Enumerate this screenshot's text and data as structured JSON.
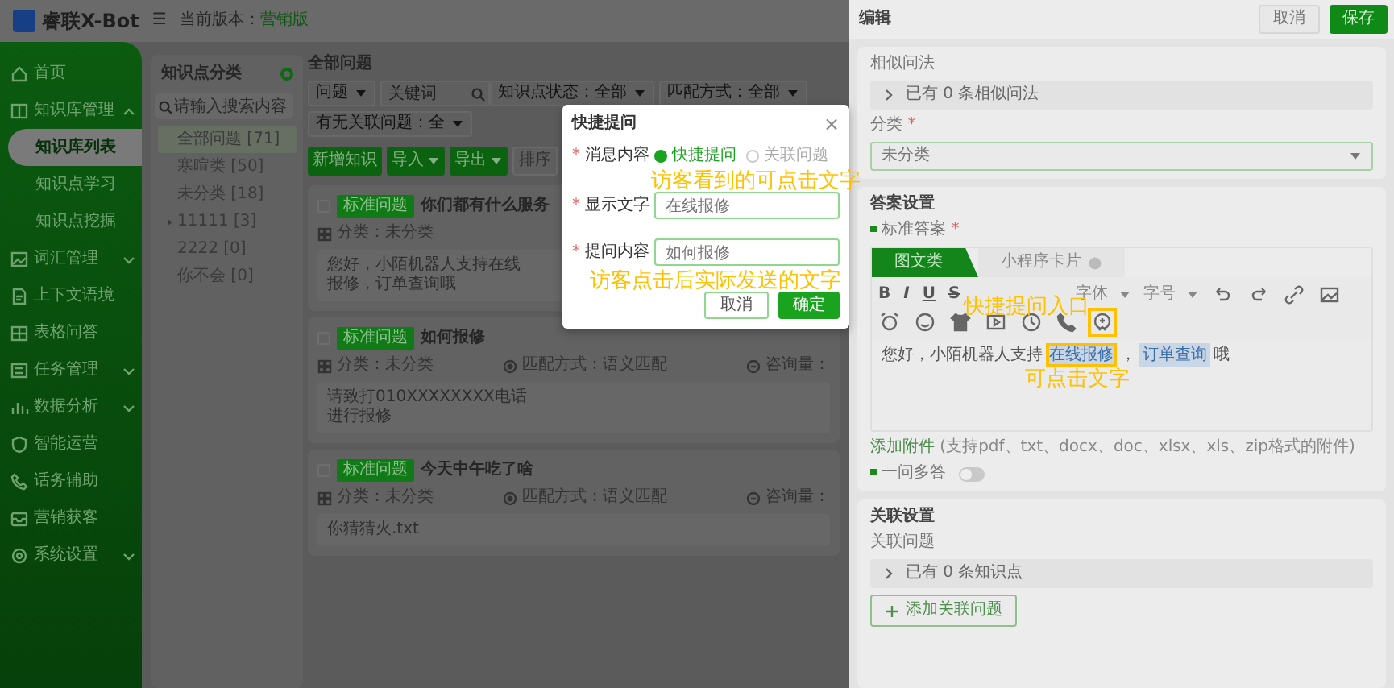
{
  "header": {
    "logo": "睿联X-Bot",
    "menu_glyph": "☰",
    "version_label": "当前版本：",
    "version": "营销版"
  },
  "sidebar": {
    "items": [
      {
        "label": "首页",
        "kind": "link",
        "selected": false
      },
      {
        "label": "知识库管理",
        "kind": "group",
        "expanded": true,
        "children": [
          {
            "label": "知识库列表",
            "selected": true
          },
          {
            "label": "知识点学习",
            "selected": false
          },
          {
            "label": "知识点挖掘",
            "selected": false
          }
        ]
      },
      {
        "label": "词汇管理",
        "kind": "group",
        "expanded": false
      },
      {
        "label": "上下文语境",
        "kind": "link",
        "selected": false
      },
      {
        "label": "表格问答",
        "kind": "link",
        "selected": false
      },
      {
        "label": "任务管理",
        "kind": "group",
        "expanded": false
      },
      {
        "label": "数据分析",
        "kind": "group",
        "expanded": false
      },
      {
        "label": "智能运营",
        "kind": "link",
        "selected": false
      },
      {
        "label": "话务辅助",
        "kind": "link",
        "selected": false
      },
      {
        "label": "营销获客",
        "kind": "link",
        "selected": false
      },
      {
        "label": "系统设置",
        "kind": "group",
        "expanded": false
      }
    ]
  },
  "categories": {
    "title": "知识点分类",
    "search": {
      "placeholder": "请输入搜索内容"
    },
    "items": [
      {
        "label": "全部问题 [71]",
        "selected": true
      },
      {
        "label": "寒暄类 [50]",
        "selected": false
      },
      {
        "label": "未分类 [18]",
        "selected": false
      },
      {
        "label": "11111 [3]",
        "selected": false,
        "expanded": false
      },
      {
        "label": "2222 [0]",
        "selected": false
      },
      {
        "label": "你不会 [0]",
        "selected": false
      }
    ]
  },
  "main": {
    "title": "全部问题",
    "filters": [
      {
        "kind": "select",
        "value": "问题"
      },
      {
        "kind": "search",
        "placeholder": "关键词"
      },
      {
        "kind": "select",
        "value": "知识点状态：全部"
      },
      {
        "kind": "select",
        "value": "匹配方式：全部"
      },
      {
        "kind": "select",
        "value": "有无关联问题：全"
      }
    ],
    "buttons": [
      {
        "label": "新增知识",
        "kind": "primary",
        "dropdown": false
      },
      {
        "label": "导入",
        "kind": "primary",
        "dropdown": true
      },
      {
        "label": "导出",
        "kind": "primary",
        "dropdown": true
      },
      {
        "label": "排序",
        "kind": "secondary",
        "dropdown": false
      }
    ],
    "items": [
      {
        "checked": false,
        "tag": "标准问题",
        "title": "你们都有什么服务",
        "category": "分类：未分类",
        "answer": "您好，小陌机器人支持在线报修，订单查询哦"
      },
      {
        "checked": false,
        "tag": "标准问题",
        "title": "如何报修",
        "category": "分类：未分类",
        "match": "匹配方式：语义匹配",
        "consult": "咨询量：",
        "answer": "请致打010XXXXXXXX电话进行报修"
      },
      {
        "checked": false,
        "tag": "标准问题",
        "title": "今天中午吃了啥",
        "category": "分类：未分类",
        "match": "匹配方式：语义匹配",
        "consult": "咨询量：",
        "answer": "你猜猜火.txt"
      }
    ]
  },
  "drawer": {
    "title": "编辑",
    "buttons": [
      {
        "label": "取消",
        "kind": "secondary"
      },
      {
        "label": "保存",
        "kind": "primary"
      }
    ],
    "similar": {
      "label": "相似问法",
      "summary": "已有 0 条相似问法",
      "expanded": false
    },
    "category": {
      "label": "分类",
      "required_mark": "*",
      "value": "未分类"
    },
    "answer": {
      "title": "答案设置",
      "label": "标准答案",
      "required_mark": "*",
      "tabs": [
        {
          "label": "图文类",
          "selected": true
        },
        {
          "label": "小程序卡片",
          "selected": false
        }
      ],
      "toolbar": {
        "format_buttons": [
          "B",
          "I",
          "U",
          "S"
        ],
        "font_select": "字体",
        "size_select": "字号",
        "quick_ask_highlighted": true
      },
      "content": [
        {
          "kind": "text",
          "text": "您好，小陌机器人支持"
        },
        {
          "kind": "link",
          "text": "在线报修",
          "highlighted": true
        },
        {
          "kind": "text",
          "text": "，"
        },
        {
          "kind": "link",
          "text": "订单查询",
          "highlighted": false
        },
        {
          "kind": "text",
          "text": "哦"
        }
      ],
      "attachment": {
        "link": "添加附件",
        "note": "(支持pdf、txt、docx、doc、xlsx、xls、zip格式的附件)"
      },
      "multi_answer": {
        "label": "一问多答",
        "on": false
      }
    },
    "relations": {
      "title": "关联设置",
      "label": "关联问题",
      "summary": "已有 0 条知识点",
      "expanded": false,
      "add_button": "添加关联问题"
    }
  },
  "modal": {
    "title": "快捷提问",
    "close": "×",
    "fields": [
      {
        "kind": "radio",
        "label": "消息内容",
        "required_mark": "*",
        "options": [
          {
            "label": "快捷提问",
            "selected": true
          },
          {
            "label": "关联问题",
            "selected": false
          }
        ]
      },
      {
        "kind": "input",
        "label": "显示文字",
        "required_mark": "*",
        "value": "在线报修"
      },
      {
        "kind": "input",
        "label": "提问内容",
        "required_mark": "*",
        "value": "如何报修"
      }
    ],
    "buttons": [
      {
        "label": "取消",
        "kind": "secondary"
      },
      {
        "label": "确定",
        "kind": "primary"
      }
    ]
  },
  "annotations": [
    {
      "text": "访客看到的可点击文字"
    },
    {
      "text": "访客点击后实际发送的文字"
    },
    {
      "text": "快捷提问入口"
    },
    {
      "text": "可点击文字"
    }
  ]
}
